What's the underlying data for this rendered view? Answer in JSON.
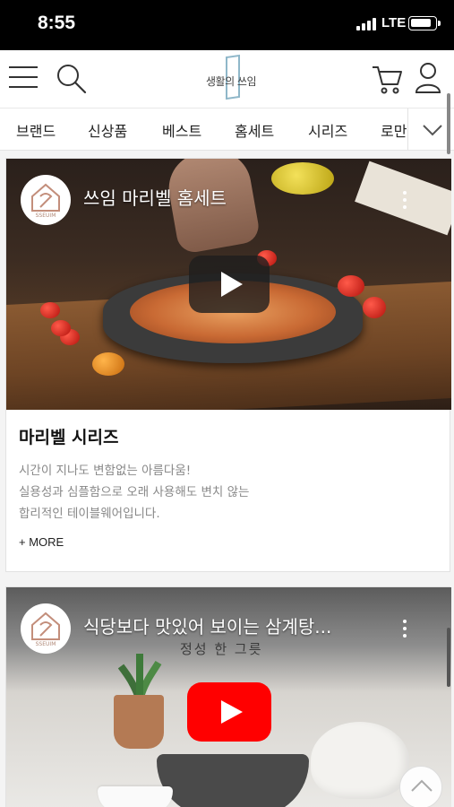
{
  "status_bar": {
    "time": "8:55",
    "network": "LTE"
  },
  "header": {
    "logo_text": "생활의 쓰임"
  },
  "categories": [
    "브랜드",
    "신상품",
    "베스트",
    "홈세트",
    "시리즈",
    "로만"
  ],
  "cards": [
    {
      "video_title": "쓰임 마리벨 홈세트",
      "title": "마리벨 시리즈",
      "description": [
        "시간이 지나도 변함없는 아름다움!",
        "실용성과 심플함으로 오래 사용해도 변치 않는",
        "합리적인 테이블웨어입니다."
      ],
      "more_label": "+ MORE"
    },
    {
      "video_title": "식당보다 맛있어 보이는 삼계탕...",
      "subtitle": "정성 한 그릇"
    }
  ],
  "channel": {
    "avatar_text": "SSEUIM"
  }
}
